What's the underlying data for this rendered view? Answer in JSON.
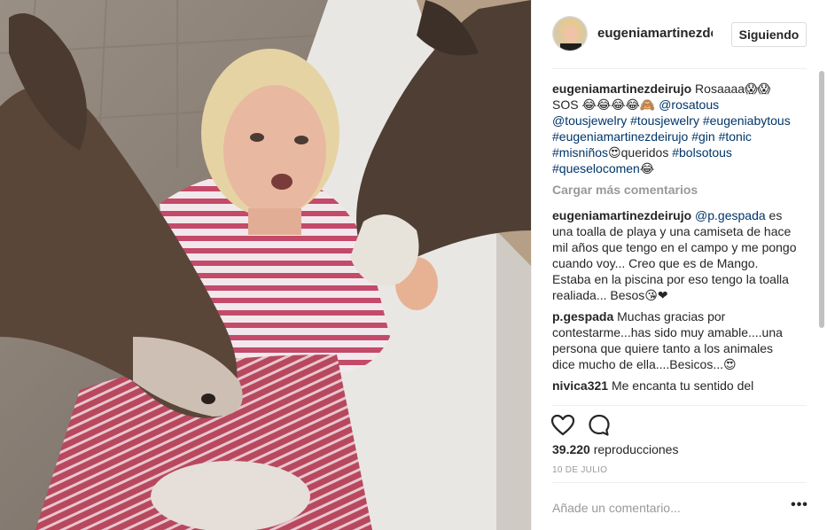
{
  "post": {
    "username": "eugeniamartinezdeirujo",
    "follow_label": "Siguiendo",
    "views_count": "39.220",
    "views_label": " reproducciones",
    "date": "10 DE JULIO",
    "add_comment_placeholder": "Añade un comentario...",
    "more_label": "•••",
    "load_more_label": "Cargar más comentarios"
  },
  "caption": {
    "user": "eugeniamartinezdeirujo",
    "text_1": " Rosaaaa😱😱 SOS 😂😂😂😂🙈",
    "mention_1": "@rosatous",
    "mention_2": "@tousjewelry",
    "tags": [
      "#tousjewelry",
      "#eugeniabytous",
      "#eugeniamartinezdeirujo",
      "#gin",
      "#tonic",
      "#misniños"
    ],
    "text_2": "😍queridos ",
    "tag_bolso": "#bolsotous",
    "tag_last": "#queselocomen",
    "text_3": "😂"
  },
  "comments": [
    {
      "user": "eugeniamartinezdeirujo",
      "mention": "@p.gespada",
      "text": " es una toalla de playa y una camiseta de hace mil años que tengo en el campo y me pongo cuando voy... Creo que es de Mango. Estaba en la piscina por eso tengo la toalla realiada... Besos😘❤"
    },
    {
      "user": "p.gespada",
      "text": " Muchas gracias por contestarme...has sido muy amable....una persona que quiere tanto a los animales dice mucho de ella....Besicos...😍"
    },
    {
      "user": "nivica321",
      "text": " Me encanta tu sentido del"
    }
  ],
  "icons": {
    "like": "heart-icon",
    "comment": "speech-bubble-icon"
  },
  "colors": {
    "link": "#003569",
    "muted": "#999999",
    "border": "#dbdbdb"
  }
}
